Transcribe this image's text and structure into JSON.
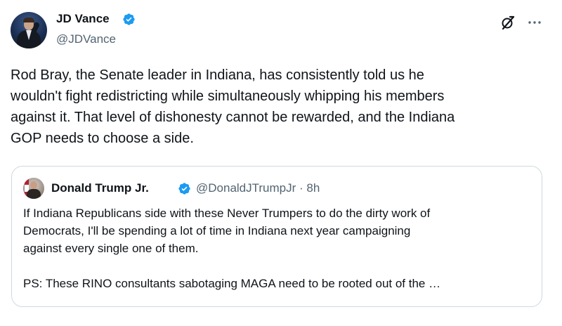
{
  "post": {
    "author_name": "JD Vance",
    "author_handle": "@JDVance",
    "verified": true,
    "text_lines": [
      "Rod Bray, the Senate leader in Indiana, has consistently told us he",
      "wouldn't fight redistricting while simultaneously whipping his members",
      "against it. That level of dishonesty cannot be rewarded, and the Indiana",
      "GOP needs to choose a side."
    ]
  },
  "quote": {
    "author_name": "Donald Trump Jr.",
    "author_handle": "@DonaldJTrumpJr",
    "separator": "·",
    "time": "8h",
    "verified": true,
    "paragraph1_lines": [
      "If Indiana Republicans side with these Never Trumpers to do the dirty work of",
      "Democrats, I'll be spending a lot of time in Indiana next year campaigning",
      "against every single one of them."
    ],
    "paragraph2_lines": [
      "PS: These RINO consultants sabotaging MAGA need to be rooted out of the …"
    ]
  },
  "icons": {
    "verified_badge": "verified-badge-icon",
    "grok": "grok-icon",
    "more": "more-icon"
  },
  "colors": {
    "text": "#0f1419",
    "secondary_text": "#536471",
    "verified_blue": "#1d9bf0",
    "border": "#cfd9de"
  }
}
